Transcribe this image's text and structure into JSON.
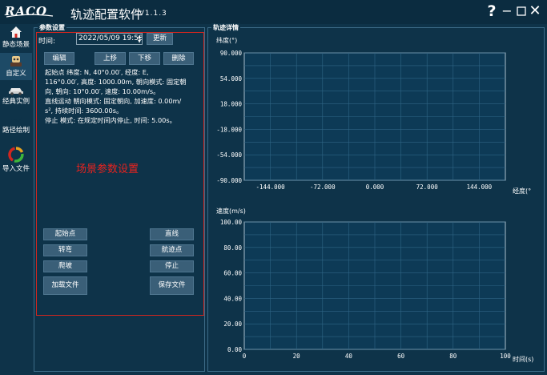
{
  "app": {
    "logo": "RACO",
    "title": "轨迹配置软件",
    "version": "-V1.1.3"
  },
  "window": {
    "help": "?",
    "min": "−",
    "max": "☐",
    "close": "✕"
  },
  "nav": {
    "items": [
      {
        "label": "静态场景",
        "icon": "house-icon"
      },
      {
        "label": "自定义",
        "icon": "robot-icon",
        "selected": true
      },
      {
        "label": "经典实例",
        "icon": "car-icon"
      },
      {
        "label": "路径绘制",
        "icon": "path-icon"
      },
      {
        "label": "导入文件",
        "icon": "import-circle-icon"
      }
    ]
  },
  "params_panel": {
    "title": "参数设置",
    "time_label": "时间:",
    "time_value": "2022/05/09 19:58:",
    "update_button": "更新",
    "edit_button": "编辑",
    "up_button": "上移",
    "down_button": "下移",
    "delete_button": "删除",
    "lines": [
      "起始点 纬度: N, 40°0.00′, 经度: E,",
      "116°0.00′, 高度: 1000.00m, 朝向模式: 固定朝",
      "向, 朝向: 10°0.00′, 速度: 10.00m/s。",
      "直线运动 朝向模式: 固定朝向, 加速度: 0.00m/",
      "s², 持续时间: 3600.00s。",
      "停止 模式: 在规定时间内停止, 时间: 5.00s。"
    ],
    "scene_label": "场景参数设置",
    "buttons": {
      "start_point": "起始点",
      "line": "直线",
      "turn": "转弯",
      "waypoint": "航迹点",
      "climb": "爬坡",
      "stop": "停止",
      "load_file": "加载文件",
      "save_file": "保存文件"
    }
  },
  "detail_panel": {
    "title": "轨迹详情"
  },
  "colors": {
    "background": "#0e3349",
    "plot_bg": "#0d3a56",
    "grid": "#2f6585",
    "accent_red": "#d2261f"
  },
  "chart_data": [
    {
      "type": "line",
      "title": "",
      "xlabel": "经度(°",
      "ylabel": "纬度(°)",
      "xlim": [
        -180,
        180
      ],
      "ylim": [
        -90,
        90
      ],
      "x_ticks": [
        "-144.000",
        "-72.000",
        "0.000",
        "72.000",
        "144.000"
      ],
      "x_tick_values": [
        -144,
        -72,
        0,
        72,
        144
      ],
      "y_ticks": [
        "90.000",
        "54.000",
        "18.000",
        "-18.000",
        "-54.000",
        "-90.000"
      ],
      "y_tick_values": [
        90,
        54,
        18,
        -18,
        -54,
        -90
      ],
      "grid": true,
      "series": []
    },
    {
      "type": "line",
      "title": "",
      "xlabel": "时间(s)",
      "ylabel": "速度(m/s)",
      "xlim": [
        0,
        100
      ],
      "ylim": [
        0,
        100
      ],
      "x_ticks": [
        "0",
        "20",
        "40",
        "60",
        "80",
        "100"
      ],
      "x_tick_values": [
        0,
        20,
        40,
        60,
        80,
        100
      ],
      "y_ticks": [
        "100.00",
        "80.00",
        "60.00",
        "40.00",
        "20.00",
        "0.00"
      ],
      "y_tick_values": [
        100,
        80,
        60,
        40,
        20,
        0
      ],
      "grid": true,
      "series": []
    }
  ]
}
